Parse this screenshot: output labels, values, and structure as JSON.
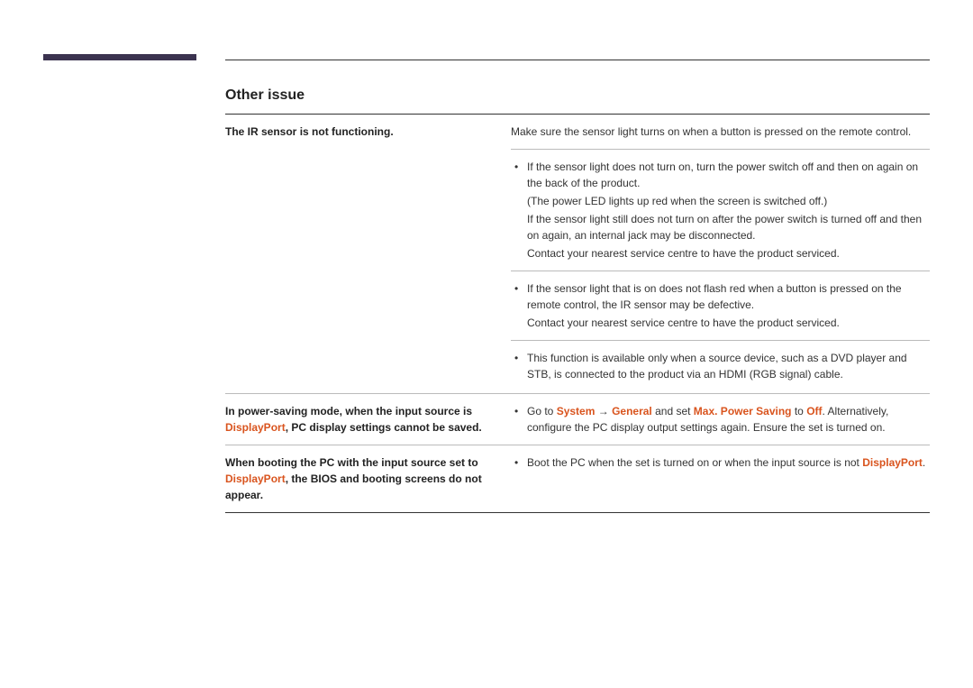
{
  "section_title": "Other issue",
  "rows": {
    "r1_left": "The IR sensor is not functioning.",
    "r1_plain": "Make sure the sensor light turns on when a button is pressed on the remote control.",
    "r1_b1_l1": "If the sensor light does not turn on, turn the power switch off and then on again on the back of the product.",
    "r1_b1_l2": "(The power LED lights up red when the screen is switched off.)",
    "r1_b1_l3": "If the sensor light still does not turn on after the power switch is turned off and then on again, an internal jack may be disconnected.",
    "r1_b1_l4": "Contact your nearest service centre to have the product serviced.",
    "r1_b2_l1": "If the sensor light that is on does not flash red when a button is pressed on the remote control, the IR sensor may be defective.",
    "r1_b2_l2": "Contact your nearest service centre to have the product serviced.",
    "r1_b3_l1": "This function is available only when a source device, such as a DVD player and STB, is connected to the product via an HDMI (RGB signal) cable.",
    "r2_left_a": "In power-saving mode, when the input source is ",
    "r2_left_dp": "DisplayPort",
    "r2_left_b": ", PC display settings cannot be saved.",
    "r2_b1_a": "Go to ",
    "r2_b1_sys": "System",
    "r2_b1_arrow": " → ",
    "r2_b1_gen": "General",
    "r2_b1_b": " and set ",
    "r2_b1_mps": "Max. Power Saving",
    "r2_b1_c": " to ",
    "r2_b1_off": "Off",
    "r2_b1_d": ". Alternatively, configure the PC display output settings again. Ensure the set is turned on.",
    "r3_left_a": "When booting the PC with the input source set to ",
    "r3_left_dp": "DisplayPort",
    "r3_left_b": ", the BIOS and booting screens do not appear.",
    "r3_b1_a": "Boot the PC when the set is turned on or when the input source is not ",
    "r3_b1_dp": "DisplayPort",
    "r3_b1_b": "."
  }
}
